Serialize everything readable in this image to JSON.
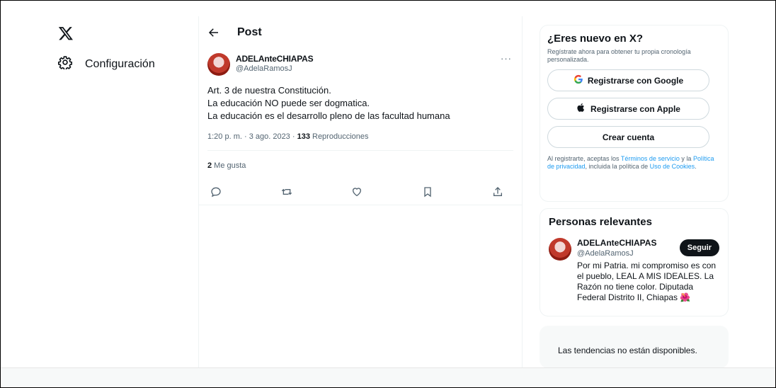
{
  "nav": {
    "settings_label": "Configuración"
  },
  "post": {
    "header_title": "Post",
    "author_name": "ADELAnteCHIAPAS",
    "author_handle": "@AdelaRamosJ",
    "more_label": "···",
    "text_lines": [
      "Art. 3 de nuestra Constitución.",
      "La educación NO puede ser dogmatica.",
      "La educación es el desarrollo pleno de las facultad humana"
    ],
    "time": "1:20 p. m. · 3 ago. 2023 · ",
    "views_count": "133",
    "views_label": " Reproducciones",
    "likes_count": "2",
    "likes_label": " Me gusta"
  },
  "signup": {
    "title": "¿Eres nuevo en X?",
    "subtitle": "Regístrate ahora para obtener tu propia cronología personalizada.",
    "google_label": "Registrarse con Google",
    "apple_label": "Registrarse con Apple",
    "create_label": "Crear cuenta",
    "legal_prefix": "Al registrarte, aceptas los ",
    "terms_link": "Términos de servicio",
    "legal_mid": " y la ",
    "privacy_link": "Política de privacidad",
    "legal_mid2": ", incluida la política de ",
    "cookies_link": "Uso de Cookies",
    "legal_suffix": "."
  },
  "people": {
    "title": "Personas relevantes",
    "name": "ADELAnteCHIAPAS",
    "handle": "@AdelaRamosJ",
    "bio": "Por mi Patria. mi compromiso es con el pueblo, LEAL A MIS IDEALES. La Razón no tiene color. Diputada Federal Distrito II, Chiapas 🌺",
    "follow_label": "Seguir"
  },
  "trends": {
    "message": "Las tendencias no están disponibles."
  },
  "colors": {
    "link": "#1d9bf0",
    "text": "#0f1419",
    "secondary": "#536471"
  }
}
